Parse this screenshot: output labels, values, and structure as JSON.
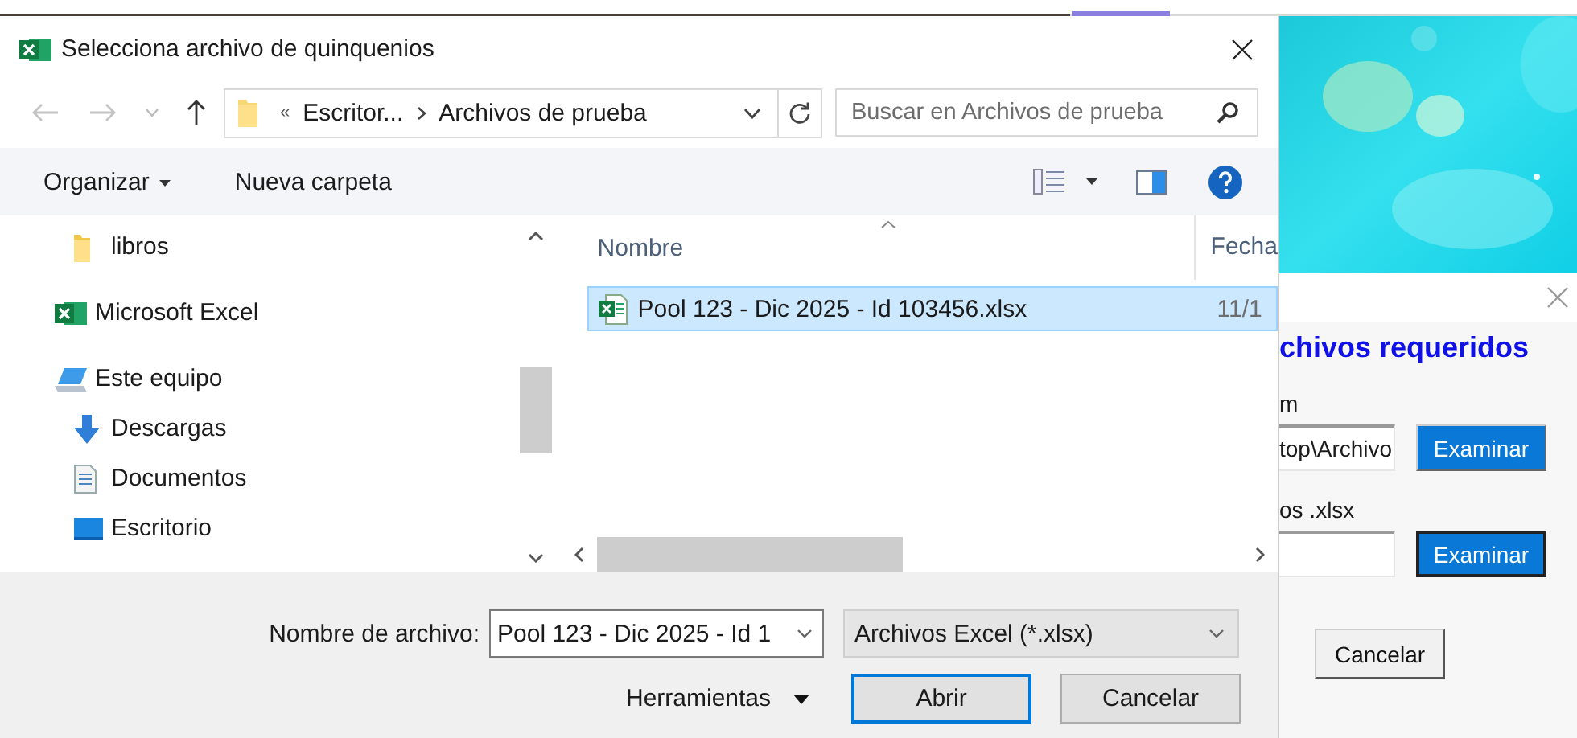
{
  "file_dialog": {
    "title": "Selecciona archivo de quinquenios",
    "address": {
      "overflow": "«",
      "segments": [
        "Escritor...",
        "Archivos de prueba"
      ]
    },
    "search": {
      "placeholder": "Buscar en Archivos de prueba"
    },
    "toolbar": [
      {
        "label": "Organizar",
        "kind": "menu"
      },
      {
        "label": "Nueva carpeta",
        "kind": "button"
      }
    ],
    "nav_pane": {
      "items": [
        {
          "label": "libros",
          "kind": "folder"
        },
        {
          "label": "Microsoft Excel",
          "kind": "excel"
        },
        {
          "label": "Este equipo",
          "kind": "computer",
          "children": [
            {
              "label": "Descargas",
              "kind": "downloads"
            },
            {
              "label": "Documentos",
              "kind": "documents"
            },
            {
              "label": "Escritorio",
              "kind": "desktop"
            }
          ]
        }
      ]
    },
    "file_list": {
      "columns": [
        "Nombre",
        "Fecha"
      ],
      "rows": [
        {
          "name": "Pool 123 - Dic 2025 - Id 103456.xlsx",
          "date": "11/1",
          "selected": true
        }
      ]
    },
    "file_name": {
      "label": "Nombre de archivo:",
      "value": "Pool 123 - Dic 2025 - Id 1"
    },
    "file_type": "Archivos Excel (*.xlsx)",
    "tools": "Herramientas",
    "buttons": [
      {
        "label": "Abrir",
        "focused": true
      },
      {
        "label": "Cancelar",
        "focused": false
      }
    ]
  },
  "back_dialog": {
    "title": "chivos requeridos",
    "fields": [
      {
        "label": "m",
        "value": "top\\Archivo",
        "button": "Examinar",
        "focused": false
      },
      {
        "label": "os .xlsx",
        "button": "Examinar",
        "focused": true
      }
    ],
    "cancel": "Cancelar"
  }
}
